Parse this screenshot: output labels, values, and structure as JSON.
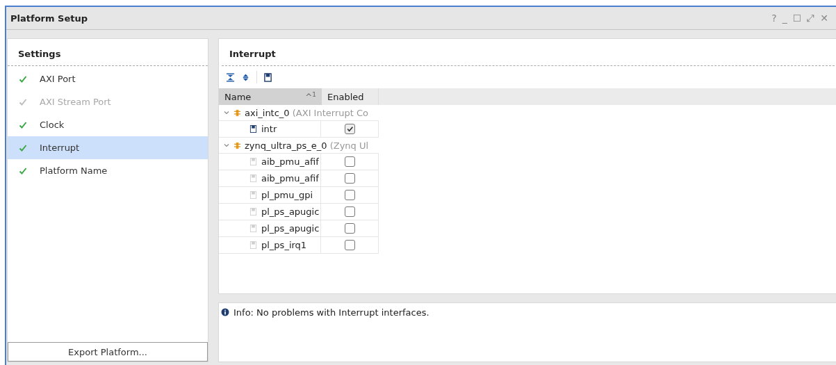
{
  "window": {
    "title": "Platform Setup",
    "controls": [
      "?",
      "_",
      "☐",
      "⤢",
      "✕"
    ]
  },
  "settings": {
    "title": "Settings",
    "items": [
      {
        "label": "AXI Port",
        "done": true,
        "disabled": false,
        "selected": false
      },
      {
        "label": "AXI Stream Port",
        "done": true,
        "disabled": true,
        "selected": false
      },
      {
        "label": "Clock",
        "done": true,
        "disabled": false,
        "selected": false
      },
      {
        "label": "Interrupt",
        "done": true,
        "disabled": false,
        "selected": true
      },
      {
        "label": "Platform Name",
        "done": true,
        "disabled": false,
        "selected": false
      }
    ],
    "export_button": "Export Platform..."
  },
  "panel": {
    "title": "Interrupt",
    "table": {
      "columns": [
        {
          "label": "Name",
          "sort": "^",
          "sort_index": "1"
        },
        {
          "label": "Enabled"
        }
      ],
      "groups": [
        {
          "name": "axi_intc_0",
          "detail": "(AXI Interrupt Co",
          "expanded": true,
          "children": [
            {
              "name": "intr",
              "enabled": true
            }
          ]
        },
        {
          "name": "zynq_ultra_ps_e_0",
          "detail": "(Zynq Ul",
          "expanded": true,
          "children": [
            {
              "name": "aib_pmu_afif",
              "enabled": false
            },
            {
              "name": "aib_pmu_afif",
              "enabled": false
            },
            {
              "name": "pl_pmu_gpi",
              "enabled": false
            },
            {
              "name": "pl_ps_apugic",
              "enabled": false
            },
            {
              "name": "pl_ps_apugic",
              "enabled": false
            },
            {
              "name": "pl_ps_irq1",
              "enabled": false
            }
          ]
        }
      ]
    },
    "message": "Info: No problems with Interrupt interfaces."
  }
}
